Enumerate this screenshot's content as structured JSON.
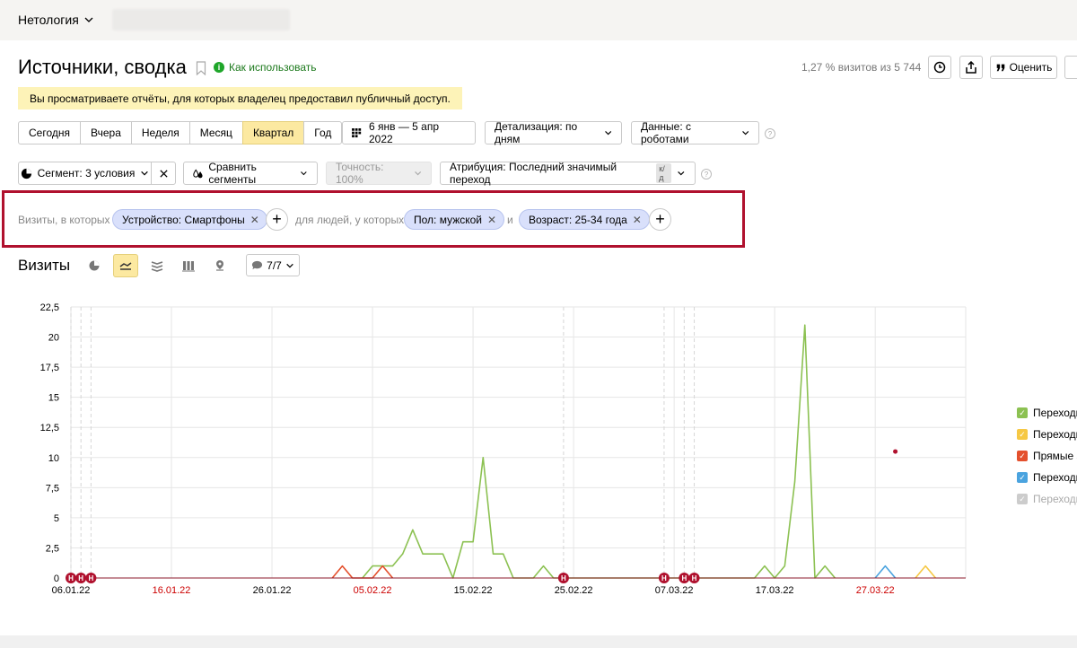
{
  "topbar": {
    "org_name": "Нетология"
  },
  "header": {
    "title": "Источники, сводка",
    "howto": "Как использовать",
    "visits_share": "1,27 % визитов из 5 744",
    "rate_label": "Оценить"
  },
  "notice": "Вы просматриваете отчёты, для которых владелец предоставил публичный доступ.",
  "period": {
    "buttons": [
      "Сегодня",
      "Вчера",
      "Неделя",
      "Месяц",
      "Квартал",
      "Год"
    ],
    "active": "Квартал",
    "date_range": "6 янв — 5 апр 2022",
    "detail": "Детализация: по дням",
    "data": "Данные: с роботами"
  },
  "controls": {
    "segment": "Сегмент: 3 условия",
    "compare": "Сравнить сегменты",
    "accuracy": "Точность: 100%",
    "attribution": "Атрибуция: Последний значимый переход",
    "attribution_badge": "к/д"
  },
  "filters": {
    "visits_label": "Визиты, в которых",
    "people_label": "для людей, у которых",
    "and_label": "и",
    "device": "Устройство: Смартфоны",
    "gender": "Пол: мужской",
    "age": "Возраст: 25-34 года"
  },
  "chart_section": {
    "title": "Визиты",
    "comments": "7/7"
  },
  "legend": [
    {
      "label": "Переходы",
      "color": "#8cc152",
      "enabled": true
    },
    {
      "label": "Переходы",
      "color": "#f6c844",
      "enabled": true
    },
    {
      "label": "Прямые з",
      "color": "#e4502d",
      "enabled": true
    },
    {
      "label": "Переходы",
      "color": "#4aa3df",
      "enabled": true
    },
    {
      "label": "Переходы",
      "color": "#cccccc",
      "enabled": false
    }
  ],
  "chart_data": {
    "type": "line",
    "y_ticks": [
      "0",
      "2,5",
      "5",
      "7,5",
      "10",
      "12,5",
      "15",
      "17,5",
      "20",
      "22,5"
    ],
    "ylim": [
      0,
      22.5
    ],
    "x_ticks": [
      {
        "label": "06.01.22",
        "day": 0,
        "weekend": false
      },
      {
        "label": "16.01.22",
        "day": 10,
        "weekend": true
      },
      {
        "label": "26.01.22",
        "day": 20,
        "weekend": false
      },
      {
        "label": "05.02.22",
        "day": 30,
        "weekend": true
      },
      {
        "label": "15.02.22",
        "day": 40,
        "weekend": false
      },
      {
        "label": "25.02.22",
        "day": 50,
        "weekend": false
      },
      {
        "label": "07.03.22",
        "day": 60,
        "weekend": false
      },
      {
        "label": "17.03.22",
        "day": 70,
        "weekend": false
      },
      {
        "label": "27.03.22",
        "day": 80,
        "weekend": true
      }
    ],
    "x_range_days": [
      0,
      89
    ],
    "holiday_marker_days": [
      0,
      1,
      2,
      49,
      59,
      61,
      62
    ],
    "holiday_marker_label": "Н",
    "series": [
      {
        "color": "#8cc152",
        "points": [
          [
            29,
            0
          ],
          [
            30,
            1
          ],
          [
            31,
            1
          ],
          [
            32,
            1
          ],
          [
            33,
            2
          ],
          [
            34,
            4
          ],
          [
            35,
            2
          ],
          [
            36,
            2
          ],
          [
            37,
            2
          ],
          [
            38,
            0
          ],
          [
            39,
            3
          ],
          [
            40,
            3
          ],
          [
            41,
            10
          ],
          [
            42,
            2
          ],
          [
            43,
            2
          ],
          [
            44,
            0
          ],
          [
            46,
            0
          ],
          [
            47,
            1
          ],
          [
            48,
            0
          ],
          [
            68,
            0
          ],
          [
            69,
            1
          ],
          [
            70,
            0
          ],
          [
            71,
            1
          ],
          [
            72,
            8
          ],
          [
            73,
            21
          ],
          [
            74,
            0
          ],
          [
            75,
            1
          ],
          [
            76,
            0
          ]
        ]
      },
      {
        "color": "#e4502d",
        "points": [
          [
            26,
            0
          ],
          [
            27,
            1
          ],
          [
            28,
            0
          ],
          [
            30,
            0
          ],
          [
            31,
            1
          ],
          [
            32,
            0
          ]
        ]
      },
      {
        "color": "#4aa3df",
        "points": [
          [
            80,
            0
          ],
          [
            81,
            1
          ],
          [
            82,
            0
          ]
        ]
      },
      {
        "color": "#f6c844",
        "points": [
          [
            84,
            0
          ],
          [
            85,
            1
          ],
          [
            86,
            0
          ]
        ]
      }
    ],
    "dot": {
      "day": 82,
      "value": 10.5,
      "color": "#b0112e"
    }
  }
}
